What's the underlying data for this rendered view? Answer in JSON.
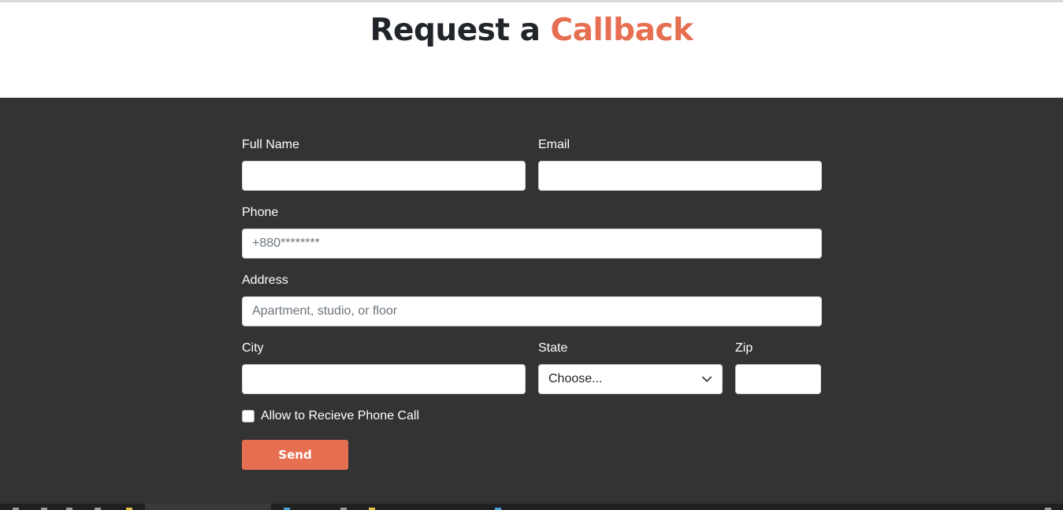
{
  "page": {
    "title_part1": "Request a ",
    "title_part2": "Callback",
    "accent_color": "#e76f51",
    "section_bg": "#333333"
  },
  "form": {
    "full_name": {
      "label": "Full Name",
      "value": "",
      "placeholder": ""
    },
    "email": {
      "label": "Email",
      "value": "",
      "placeholder": ""
    },
    "phone": {
      "label": "Phone",
      "value": "",
      "placeholder": "+880********"
    },
    "address": {
      "label": "Address",
      "value": "",
      "placeholder": "Apartment, studio, or floor"
    },
    "city": {
      "label": "City",
      "value": "",
      "placeholder": ""
    },
    "state": {
      "label": "State",
      "selected": "Choose...",
      "icon": "chevron-down-icon"
    },
    "zip": {
      "label": "Zip",
      "value": "",
      "placeholder": ""
    },
    "allow_call": {
      "label": "Allow to Recieve Phone Call",
      "checked": false
    },
    "submit_label": "Send"
  }
}
